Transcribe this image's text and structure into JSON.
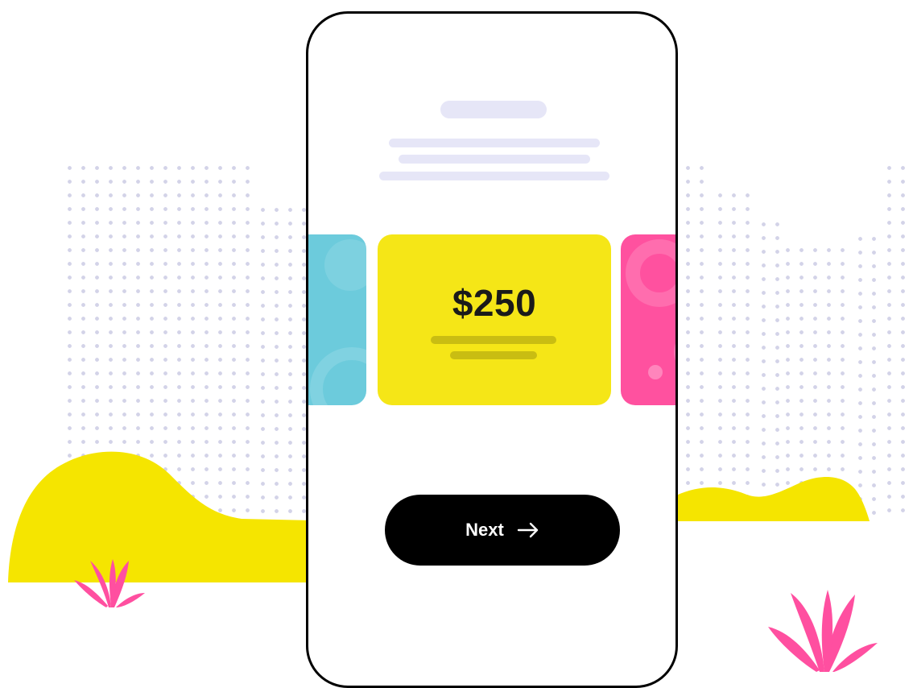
{
  "card": {
    "amount": "$250"
  },
  "actions": {
    "next_label": "Next"
  },
  "icons": {
    "next_arrow": "arrow-right-icon",
    "plant_left": "leaf-plant-icon",
    "plant_right": "leaf-plant-icon"
  },
  "colors": {
    "yellow_card": "#f5e617",
    "blue_card": "#6ccbdc",
    "pink_card": "#ff519f",
    "button": "#000000",
    "skeleton": "#e6e6f7",
    "hill_yellow": "#f5e500",
    "plant_pink": "#ff4fa0",
    "dots": "#d3d3e8"
  }
}
